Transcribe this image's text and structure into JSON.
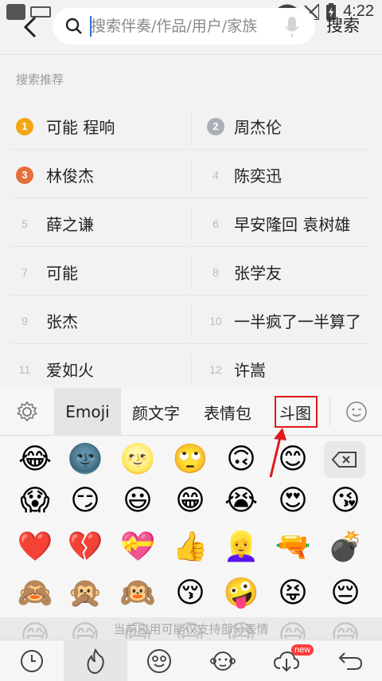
{
  "status_bar": {
    "time": "4:22"
  },
  "header": {
    "search_placeholder": "搜索伴奏/作品/用户/家族",
    "search_button": "搜索"
  },
  "section_title": "搜索推荐",
  "suggestions": [
    {
      "rank": "1",
      "text": "可能 程响",
      "badge_color": "#f3a614"
    },
    {
      "rank": "2",
      "text": "周杰伦",
      "badge_color": "#a9b0b8"
    },
    {
      "rank": "3",
      "text": "林俊杰",
      "badge_color": "#e56f3b"
    },
    {
      "rank": "4",
      "text": "陈奕迅"
    },
    {
      "rank": "5",
      "text": "薛之谦"
    },
    {
      "rank": "6",
      "text": "早安隆回 袁树雄"
    },
    {
      "rank": "7",
      "text": "可能"
    },
    {
      "rank": "8",
      "text": "张学友"
    },
    {
      "rank": "9",
      "text": "张杰"
    },
    {
      "rank": "10",
      "text": "一半疯了一半算了"
    },
    {
      "rank": "11",
      "text": "爱如火"
    },
    {
      "rank": "12",
      "text": "许嵩"
    }
  ],
  "keyboard": {
    "tabs": [
      "Emoji",
      "颜文字",
      "表情包",
      "斗图"
    ],
    "active_tab": "Emoji",
    "highlight_color": "#e0191a",
    "emoji_rows": [
      [
        "😂",
        "🌚",
        "🌝",
        "🙄",
        "🙃",
        "😊"
      ],
      [
        "😱",
        "😏",
        "😃",
        "😁",
        "😭",
        "😍",
        "😘"
      ],
      [
        "❤️",
        "💔",
        "💝",
        "👍",
        "👱‍♀️",
        "🔫",
        "💣"
      ],
      [
        "🙈",
        "🙊",
        "🙉",
        "😚",
        "🤪",
        "😝",
        "😔"
      ],
      [
        "😅",
        "😅",
        "😅",
        "😅",
        "😅",
        "😅",
        "😅"
      ]
    ],
    "notice": "当前应用可能仅支持部分表情",
    "new_badge": "new"
  }
}
